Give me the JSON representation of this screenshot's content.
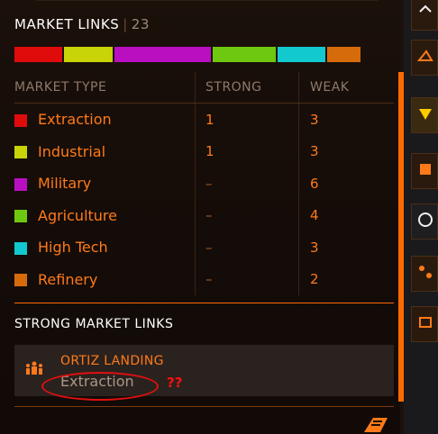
{
  "market_links": {
    "title": "MARKET LINKS",
    "count": "23",
    "bar_segments": [
      {
        "type": "Extraction",
        "color": "#e00b0b",
        "share": 0.13
      },
      {
        "type": "Industrial",
        "color": "#c8d308",
        "share": 0.13
      },
      {
        "type": "Military",
        "color": "#b90fc0",
        "share": 0.26
      },
      {
        "type": "Agriculture",
        "color": "#6ec80f",
        "share": 0.17
      },
      {
        "type": "High Tech",
        "color": "#12c9d0",
        "share": 0.13
      },
      {
        "type": "Refinery",
        "color": "#d66b0c",
        "share": 0.09
      }
    ],
    "columns": [
      "MARKET TYPE",
      "STRONG",
      "WEAK"
    ],
    "rows": [
      {
        "type": "Extraction",
        "color": "#e00b0b",
        "strong": "1",
        "weak": "3"
      },
      {
        "type": "Industrial",
        "color": "#c8d308",
        "strong": "1",
        "weak": "3"
      },
      {
        "type": "Military",
        "color": "#b90fc0",
        "strong": "–",
        "weak": "6"
      },
      {
        "type": "Agriculture",
        "color": "#6ec80f",
        "strong": "–",
        "weak": "4"
      },
      {
        "type": "High Tech",
        "color": "#12c9d0",
        "strong": "–",
        "weak": "3"
      },
      {
        "type": "Refinery",
        "color": "#d66b0c",
        "strong": "–",
        "weak": "2"
      }
    ]
  },
  "strong_links": {
    "title": "STRONG MARKET LINKS",
    "items": [
      {
        "name": "ORTIZ LANDING",
        "type": "Extraction",
        "icon": "population-icon"
      }
    ],
    "annotation": "??"
  },
  "side_panel": {
    "zero_label": "0"
  },
  "colors": {
    "accent": "#ff7a1a",
    "scrollbar": "#ff6a00",
    "annotation": "#ff1010"
  }
}
